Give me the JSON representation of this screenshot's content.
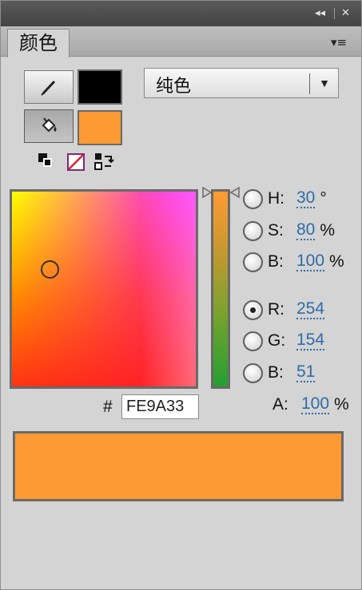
{
  "titlebar": {
    "collapse_icon": "◂◂",
    "close_icon": "✕"
  },
  "tab": {
    "label": "颜色"
  },
  "panel_menu_icon": "▾≡",
  "colors": {
    "stroke": "#000000",
    "fill": "#FE9A33",
    "hue_field_from": "#FFFF00",
    "hue_field_to": "#FF00FF",
    "preview": "#FE9A33"
  },
  "fill_type": {
    "selected": "纯色",
    "arrow": "▼"
  },
  "channels": {
    "h": {
      "label": "H:",
      "value": "30",
      "unit": "°"
    },
    "s": {
      "label": "S:",
      "value": "80",
      "unit": "%"
    },
    "b": {
      "label": "B:",
      "value": "100",
      "unit": "%"
    },
    "r": {
      "label": "R:",
      "value": "254"
    },
    "g": {
      "label": "G:",
      "value": "154"
    },
    "b2": {
      "label": "B:",
      "value": "51"
    },
    "a": {
      "label": "A:",
      "value": "100",
      "unit": "%"
    }
  },
  "selected_channel": "R",
  "hex": {
    "hash": "#",
    "value": "FE9A33"
  }
}
